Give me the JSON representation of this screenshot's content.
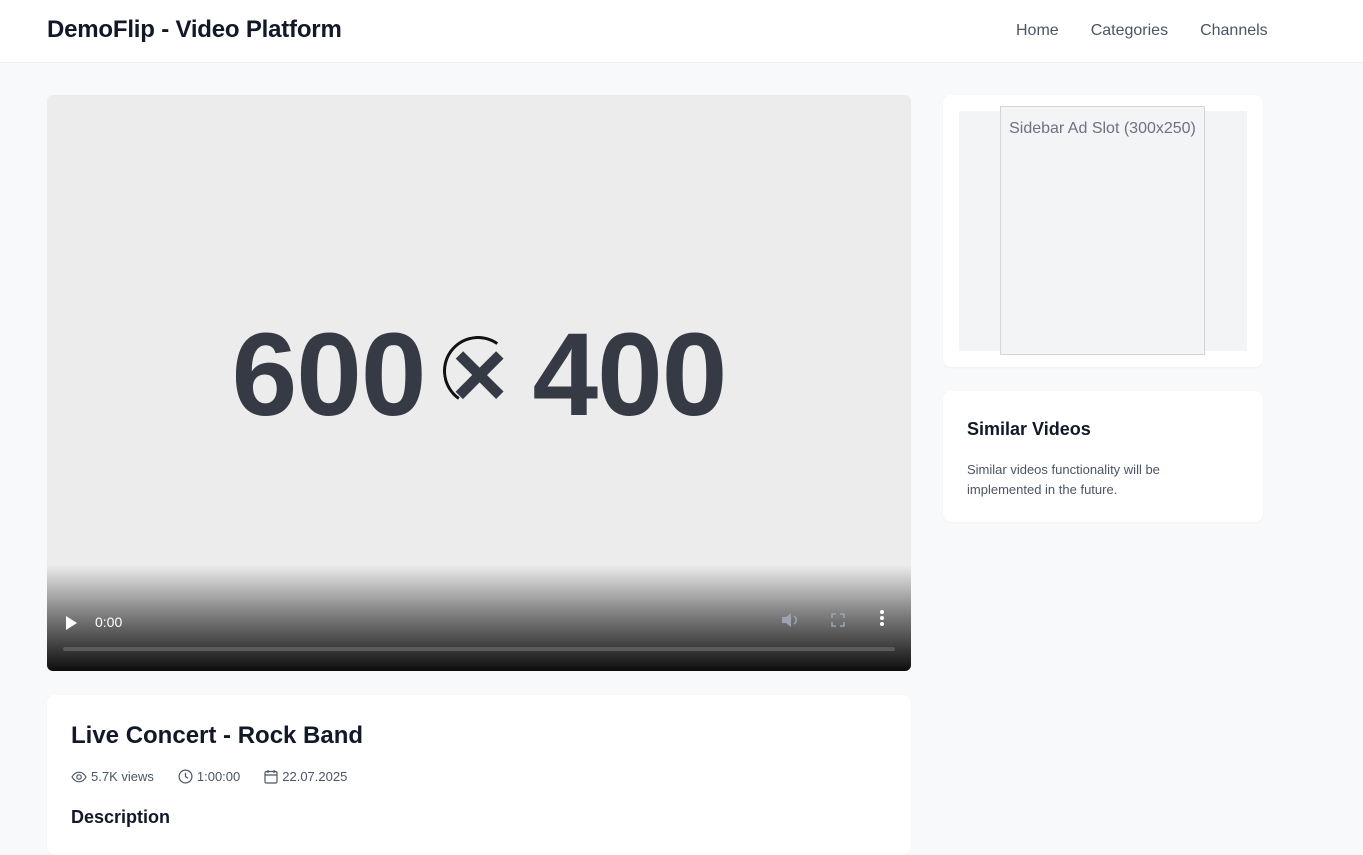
{
  "header": {
    "brand": "DemoFlip - Video Platform",
    "nav": [
      "Home",
      "Categories",
      "Channels"
    ]
  },
  "player": {
    "placeholder_left": "600",
    "placeholder_sep": "×",
    "placeholder_right": "400",
    "time": "0:00",
    "progress": 0
  },
  "video": {
    "title": "Live Concert - Rock Band",
    "views": "5.7K views",
    "duration": "1:00:00",
    "date": "22.07.2025",
    "description_heading": "Description"
  },
  "sidebar": {
    "ad_label": "Sidebar Ad Slot (300x250)",
    "similar_title": "Similar Videos",
    "similar_text": "Similar videos functionality will be implemented in the future."
  },
  "icons": {
    "views": "eye-icon",
    "duration": "clock-icon",
    "date": "calendar-icon",
    "play": "play-icon",
    "mute": "volume-icon",
    "fullscreen": "fullscreen-icon",
    "more": "more-vertical-icon"
  },
  "colors": {
    "page_bg": "#f8f9fb",
    "text_primary": "#111827",
    "text_secondary": "#4b5563"
  }
}
